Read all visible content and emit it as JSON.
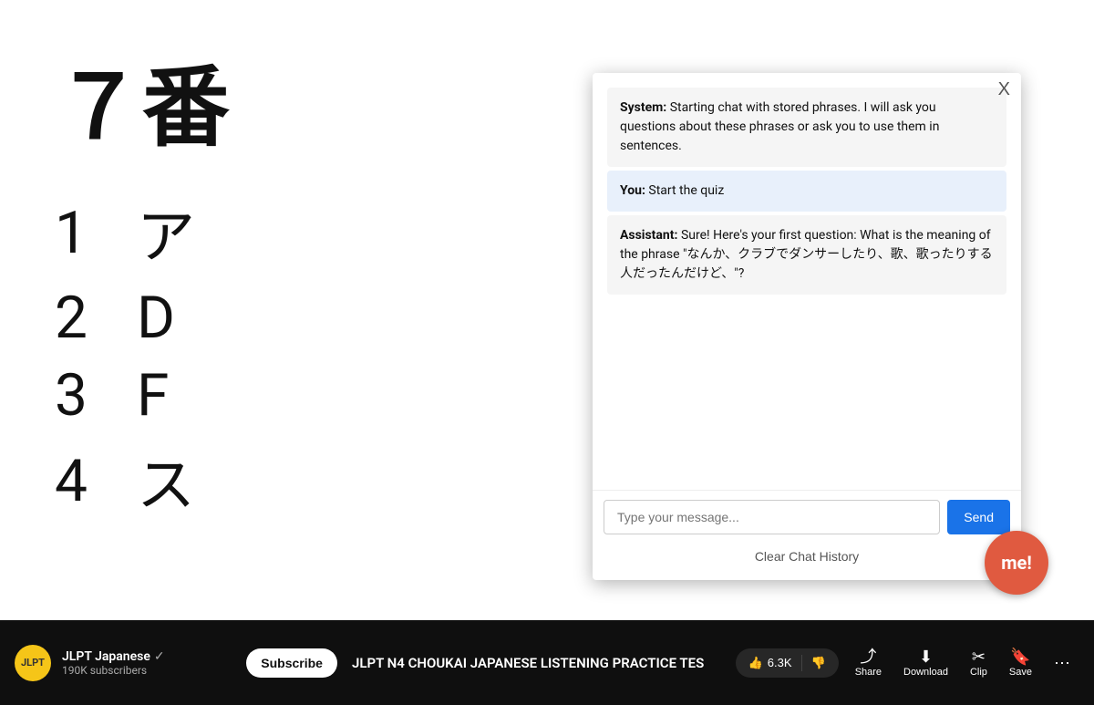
{
  "video": {
    "background_color": "#ffffff",
    "question_number": "７番",
    "answers": [
      {
        "num": "1",
        "text": "ア"
      },
      {
        "num": "2",
        "text": "D"
      },
      {
        "num": "3",
        "text": "F"
      },
      {
        "num": "4",
        "text": "ス"
      }
    ]
  },
  "chat": {
    "close_label": "X",
    "messages": [
      {
        "type": "system",
        "sender": "System:",
        "text": " Starting chat with stored phrases. I will ask you questions about these phrases or ask you to use them in sentences."
      },
      {
        "type": "user",
        "sender": "You:",
        "text": " Start the quiz"
      },
      {
        "type": "assistant",
        "sender": "Assistant:",
        "text": " Sure! Here's your first question: What is the meaning of the phrase \"なんか、クラブでダンサーしたり、歌、歌ったりする人だったんだけど、\"?"
      }
    ],
    "input_placeholder": "Type your message...",
    "send_label": "Send",
    "clear_label": "Clear Chat History"
  },
  "me_button": {
    "label": "me!"
  },
  "bottom_bar": {
    "channel_avatar_text": "JLPT",
    "channel_name": "JLPT Japanese",
    "channel_subs": "190K subscribers",
    "subscribe_label": "Subscribe",
    "video_title": "JLPT N4 CHOUKAI JAPANESE LISTENING PRACTICE TES",
    "like_count": "6.3K",
    "share_label": "Share",
    "download_label": "Download",
    "clip_label": "Clip",
    "save_label": "Save",
    "more_label": "···"
  }
}
